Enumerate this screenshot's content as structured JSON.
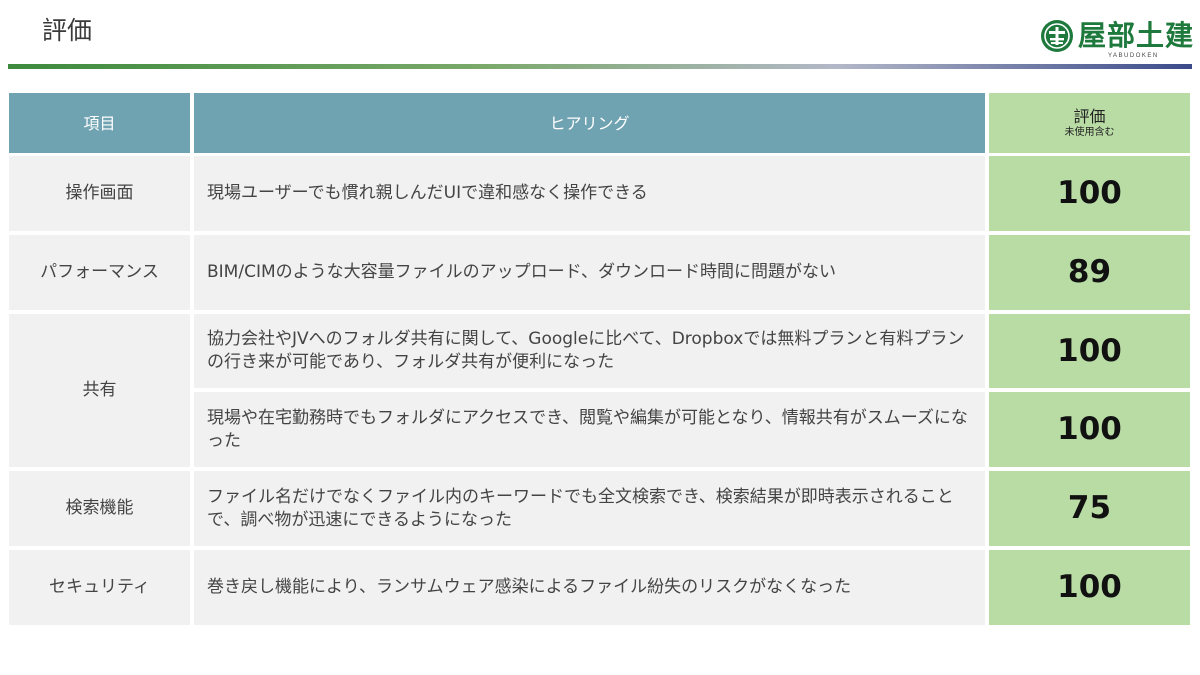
{
  "page": {
    "title": "評価"
  },
  "logo": {
    "name": "屋部土建",
    "sub": "YABUDOKEN",
    "icon": "company-emblem"
  },
  "table": {
    "headers": {
      "item": "項目",
      "hearing": "ヒアリング",
      "score": "評価",
      "score_note": "未使用含む"
    },
    "rows": [
      {
        "item": "操作画面",
        "hearing": "現場ユーザーでも慣れ親しんだUIで違和感なく操作できる",
        "score": "100"
      },
      {
        "item": "パフォーマンス",
        "hearing": "BIM/CIMのような大容量ファイルのアップロード、ダウンロード時間に問題がない",
        "score": "89"
      },
      {
        "item": "共有",
        "hearing": "協力会社やJVへのフォルダ共有に関して、Googleに比べて、Dropboxでは無料プランと有料プランの行き来が可能であり、フォルダ共有が便利になった",
        "score": "100"
      },
      {
        "item": "",
        "hearing": "現場や在宅勤務時でもフォルダにアクセスでき、閲覧や編集が可能となり、情報共有がスムーズになった",
        "score": "100"
      },
      {
        "item": "検索機能",
        "hearing": "ファイル名だけでなくファイル内のキーワードでも全文検索でき、検索結果が即時表示されることで、調べ物が迅速にできるようになった",
        "score": "75"
      },
      {
        "item": "セキュリティ",
        "hearing": "巻き戻し機能により、ランサムウェア感染によるファイル紛失のリスクがなくなった",
        "score": "100"
      }
    ]
  },
  "colors": {
    "header_blue": "#6fa3b2",
    "score_green": "#b9dca5",
    "row_gray": "#f1f1f1",
    "brand_green": "#1e7a3c"
  }
}
